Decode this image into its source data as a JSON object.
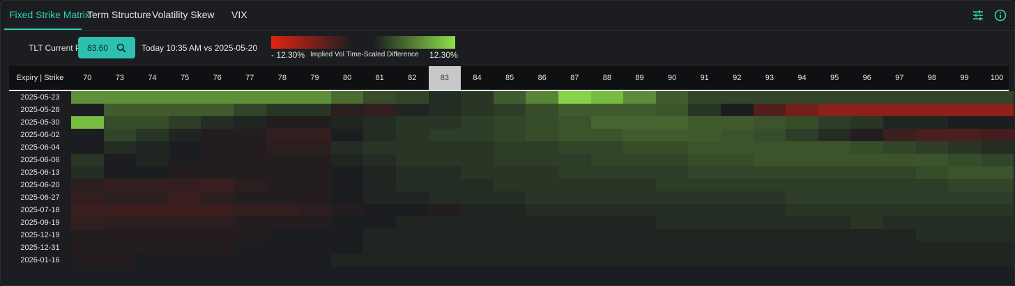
{
  "tabs": [
    {
      "label": "Fixed Strike Matrix",
      "active": true
    },
    {
      "label": "Term Structure",
      "active": false
    },
    {
      "label": "Volatility Skew",
      "active": false
    },
    {
      "label": "VIX",
      "active": false
    }
  ],
  "header_icons": [
    "sliders-icon",
    "info-icon"
  ],
  "controls": {
    "price_label": "TLT Current Price:",
    "price_value": "83.60",
    "compare_text": "Today 10:35 AM vs 2025-05-20",
    "legend_min": "- 12.30%",
    "legend_max": "12.30%",
    "legend_title": "Implied Vol Time-Scaled Difference"
  },
  "colors": {
    "accent": "#2fd0b6",
    "button": "#2ebfae",
    "neg_max": "#e02414",
    "pos_max": "#8ee04a",
    "neutral": "#1b1d20"
  },
  "chart_data": {
    "type": "heatmap",
    "corner_label": "Expiry | Strike",
    "current_strike": "83",
    "x": [
      "70",
      "73",
      "74",
      "75",
      "76",
      "77",
      "78",
      "79",
      "80",
      "81",
      "82",
      "83",
      "84",
      "85",
      "86",
      "87",
      "88",
      "89",
      "90",
      "91",
      "92",
      "93",
      "94",
      "95",
      "96",
      "97",
      "98",
      "99",
      "100"
    ],
    "y": [
      "2025-05-23",
      "2025-05-28",
      "2025-05-30",
      "2025-06-02",
      "2025-06-04",
      "2025-06-06",
      "2025-06-13",
      "2025-06-20",
      "2025-06-27",
      "2025-07-18",
      "2025-09-19",
      "2025-12-19",
      "2025-12-31",
      "2026-01-16"
    ],
    "vmin": -12.3,
    "vmax": 12.3,
    "values": [
      [
        7.2,
        7.2,
        7.2,
        7.2,
        7.2,
        7.2,
        7.2,
        7.2,
        5.0,
        3.0,
        2.5,
        1.0,
        1.5,
        4.0,
        6.5,
        11.5,
        10.0,
        7.0,
        4.0,
        2.5,
        2.5,
        2.5,
        2.5,
        2.5,
        2.5,
        2.5,
        2.5,
        2.5,
        2.5
      ],
      [
        0.0,
        4.0,
        4.0,
        4.0,
        4.0,
        2.5,
        1.5,
        1.5,
        -1.0,
        -1.5,
        0.5,
        1.0,
        1.5,
        2.0,
        3.0,
        4.0,
        4.0,
        4.0,
        3.5,
        1.5,
        0.0,
        -3.5,
        -5.5,
        -7.0,
        -7.0,
        -7.0,
        -7.0,
        -7.0,
        -7.0
      ],
      [
        10.0,
        3.0,
        3.0,
        2.0,
        1.0,
        0.5,
        -0.5,
        -0.5,
        0.5,
        1.0,
        1.5,
        1.5,
        2.0,
        2.5,
        3.0,
        3.5,
        4.5,
        4.5,
        4.5,
        4.0,
        4.0,
        3.5,
        3.0,
        2.0,
        1.5,
        0.5,
        0.5,
        0.0,
        0.0
      ],
      [
        0.0,
        2.5,
        1.5,
        0.5,
        -0.5,
        -0.5,
        -1.5,
        -1.5,
        0.0,
        1.0,
        1.5,
        2.0,
        2.0,
        2.5,
        3.0,
        3.5,
        3.5,
        4.0,
        4.0,
        4.0,
        3.5,
        3.0,
        2.0,
        1.0,
        -0.5,
        -2.0,
        -3.0,
        -3.0,
        -2.5
      ],
      [
        0.0,
        1.0,
        0.5,
        0.0,
        -0.5,
        -0.5,
        -1.0,
        -1.0,
        1.0,
        1.5,
        1.5,
        1.5,
        1.5,
        2.0,
        2.0,
        2.5,
        2.5,
        3.0,
        3.0,
        3.5,
        3.5,
        3.5,
        3.5,
        3.5,
        3.0,
        2.5,
        2.0,
        1.5,
        1.0
      ],
      [
        1.5,
        0.0,
        0.5,
        0.0,
        -0.5,
        -0.5,
        -0.5,
        -0.5,
        0.5,
        1.0,
        1.5,
        1.5,
        1.5,
        2.0,
        2.0,
        2.0,
        2.5,
        2.5,
        2.5,
        3.0,
        3.0,
        3.5,
        3.5,
        3.5,
        3.5,
        3.5,
        3.5,
        3.0,
        2.5
      ],
      [
        1.0,
        0.0,
        0.0,
        -0.5,
        -0.5,
        -0.5,
        -0.5,
        -0.5,
        0.0,
        0.5,
        1.0,
        1.0,
        1.5,
        1.5,
        1.5,
        2.0,
        2.0,
        2.0,
        2.0,
        2.5,
        2.5,
        2.5,
        2.5,
        2.5,
        2.5,
        2.5,
        3.0,
        3.5,
        3.5
      ],
      [
        -1.0,
        -1.5,
        -1.5,
        -1.5,
        -2.0,
        -1.0,
        -0.5,
        -0.5,
        0.0,
        0.5,
        1.0,
        1.0,
        1.0,
        1.5,
        1.5,
        1.5,
        1.5,
        1.5,
        2.0,
        2.0,
        2.0,
        2.0,
        2.0,
        2.0,
        2.0,
        2.0,
        2.0,
        2.5,
        2.5
      ],
      [
        -1.5,
        -1.0,
        -1.0,
        -2.0,
        -1.0,
        -0.5,
        -0.5,
        -0.5,
        0.0,
        0.5,
        0.5,
        1.0,
        1.0,
        1.0,
        1.5,
        1.5,
        1.5,
        1.5,
        1.5,
        1.5,
        1.5,
        1.5,
        2.0,
        2.0,
        2.0,
        2.0,
        2.0,
        2.0,
        2.0
      ],
      [
        -2.0,
        -2.0,
        -2.0,
        -2.0,
        -2.0,
        -1.5,
        -1.5,
        -1.0,
        -0.5,
        0.0,
        0.0,
        -0.5,
        0.5,
        0.5,
        1.0,
        1.0,
        1.0,
        1.0,
        1.0,
        1.0,
        1.0,
        1.0,
        1.5,
        1.5,
        1.5,
        1.5,
        1.5,
        1.5,
        1.5
      ],
      [
        -1.5,
        -1.0,
        -1.0,
        -1.0,
        -1.0,
        -0.5,
        -0.5,
        -0.5,
        0.0,
        0.0,
        0.5,
        0.5,
        0.5,
        0.5,
        0.5,
        0.5,
        0.5,
        0.5,
        1.0,
        1.0,
        1.0,
        1.0,
        1.0,
        1.0,
        1.5,
        1.0,
        1.0,
        1.0,
        1.0
      ],
      [
        -0.5,
        -0.5,
        -0.5,
        -0.5,
        -0.5,
        -0.5,
        0.0,
        0.0,
        0.0,
        0.5,
        0.5,
        0.5,
        0.5,
        0.5,
        0.5,
        0.5,
        0.5,
        0.5,
        0.5,
        0.5,
        0.5,
        0.5,
        0.5,
        0.5,
        0.5,
        0.5,
        1.0,
        1.0,
        1.0
      ],
      [
        -0.5,
        -0.5,
        -0.5,
        -0.5,
        -0.5,
        0.0,
        0.0,
        0.0,
        0.0,
        0.5,
        0.5,
        0.5,
        0.5,
        0.5,
        0.5,
        0.5,
        0.5,
        0.5,
        0.5,
        0.5,
        0.5,
        0.5,
        0.5,
        0.5,
        0.5,
        0.5,
        0.5,
        0.5,
        0.5
      ],
      [
        -0.5,
        -0.5,
        0.0,
        0.0,
        0.0,
        0.0,
        0.0,
        0.0,
        0.5,
        0.5,
        0.5,
        0.5,
        0.5,
        0.5,
        0.5,
        0.5,
        0.5,
        0.5,
        0.5,
        0.5,
        0.5,
        0.5,
        0.5,
        0.5,
        0.5,
        0.5,
        0.5,
        0.5,
        0.5
      ]
    ]
  }
}
